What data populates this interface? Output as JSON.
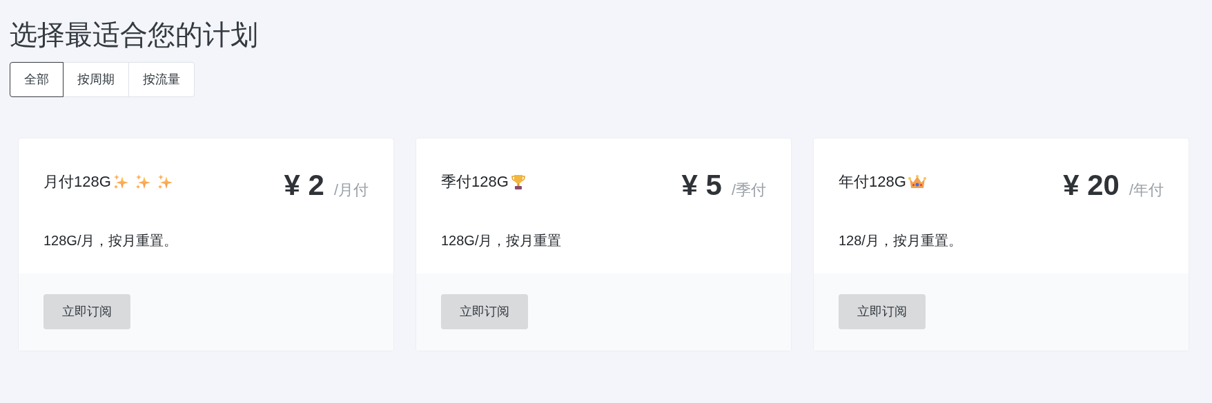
{
  "title": "选择最适合您的计划",
  "tabs": [
    {
      "label": "全部",
      "selected": true
    },
    {
      "label": "按周期",
      "selected": false
    },
    {
      "label": "按流量",
      "selected": false
    }
  ],
  "plans": [
    {
      "name": "月付128G",
      "price": "¥ 2",
      "period": "/月付",
      "description": "128G/月，按月重置。",
      "button": "立即订阅"
    },
    {
      "name": "季付128G",
      "price": "¥ 5",
      "period": "/季付",
      "description": "128G/月，按月重置",
      "button": "立即订阅"
    },
    {
      "name": "年付128G",
      "price": "¥ 20",
      "period": "/年付",
      "description": "128/月，按月重置。",
      "button": "立即订阅"
    }
  ]
}
